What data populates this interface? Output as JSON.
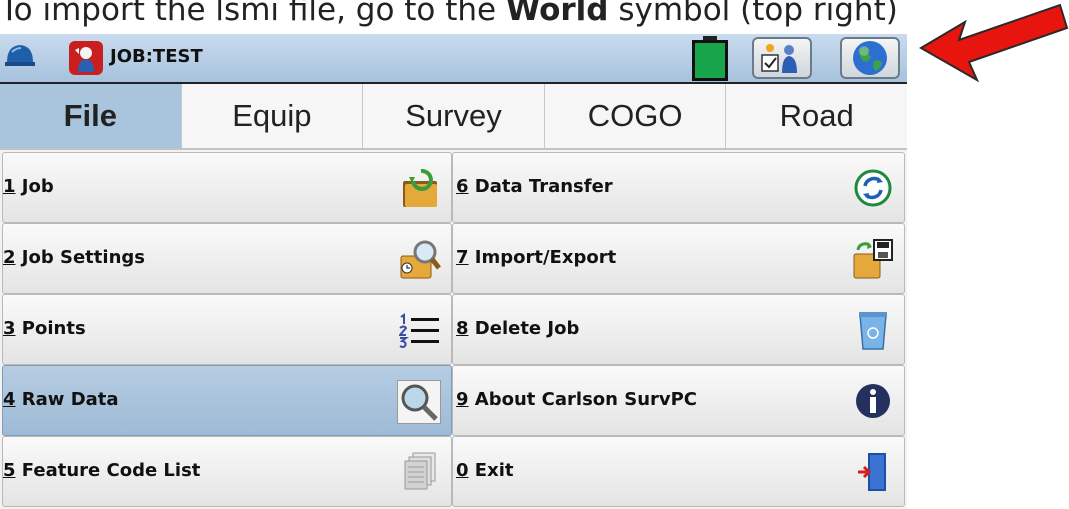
{
  "caption": {
    "prefix": "To import the lsmi file, go to the ",
    "bold": "World",
    "suffix": " symbol (top right)"
  },
  "titlebar": {
    "job_label": "JOB:TEST",
    "icons": [
      "helmet-icon",
      "carlson-app-icon",
      "battery-icon",
      "settings-icon",
      "world-icon"
    ]
  },
  "tabs": [
    {
      "label": "File",
      "active": true
    },
    {
      "label": "Equip",
      "active": false
    },
    {
      "label": "Survey",
      "active": false
    },
    {
      "label": "COGO",
      "active": false
    },
    {
      "label": "Road",
      "active": false
    }
  ],
  "menu": {
    "left": [
      {
        "num": "1",
        "text": " Job",
        "icon": "job-folder-icon"
      },
      {
        "num": "2",
        "text": " Job Settings",
        "icon": "job-settings-icon"
      },
      {
        "num": "3",
        "text": " Points",
        "icon": "points-list-icon"
      },
      {
        "num": "4",
        "text": " Raw Data",
        "icon": "magnifier-icon",
        "selected": true
      },
      {
        "num": "5",
        "text": " Feature Code List",
        "icon": "code-list-icon"
      }
    ],
    "right": [
      {
        "num": "6",
        "text": " Data Transfer",
        "icon": "transfer-icon"
      },
      {
        "num": "7",
        "text": " Import/Export",
        "icon": "import-export-icon"
      },
      {
        "num": "8",
        "text": " Delete Job",
        "icon": "recycle-bin-icon"
      },
      {
        "num": "9",
        "text": " About Carlson SurvPC",
        "icon": "info-icon"
      },
      {
        "num": "0",
        "text": " Exit",
        "icon": "exit-door-icon"
      }
    ]
  },
  "colors": {
    "accent": "#a9c4dd",
    "annotation_arrow": "#e8140e"
  }
}
